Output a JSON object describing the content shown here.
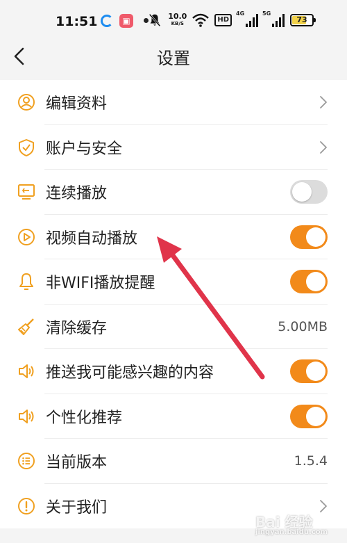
{
  "status_bar": {
    "time": "11:51",
    "speed_value": "10.0",
    "speed_unit": "KB/S",
    "hd": "HD",
    "sig1_label": "4G",
    "sig2_label": "5G",
    "battery": "73",
    "battery_level_percent": 73
  },
  "header": {
    "title": "设置"
  },
  "colors": {
    "accent": "#f28a1a",
    "icon": "#f0a020",
    "toggle_off": "#dcdcdc",
    "arrow": "#e0344a"
  },
  "settings": [
    {
      "label": "编辑资料",
      "icon": "user-icon",
      "control": "chevron"
    },
    {
      "label": "账户与安全",
      "icon": "shield-icon",
      "control": "chevron"
    },
    {
      "label": "连续播放",
      "icon": "screen-icon",
      "control": "toggle",
      "on": false
    },
    {
      "label": "视频自动播放",
      "icon": "play-icon",
      "control": "toggle",
      "on": true
    },
    {
      "label": "非WIFI播放提醒",
      "icon": "bell-icon",
      "control": "toggle",
      "on": true
    },
    {
      "label": "清除缓存",
      "icon": "broom-icon",
      "control": "value",
      "value": "5.00MB"
    },
    {
      "label": "推送我可能感兴趣的内容",
      "icon": "speaker-icon",
      "control": "toggle",
      "on": true
    },
    {
      "label": "个性化推荐",
      "icon": "speaker-icon",
      "control": "toggle",
      "on": true
    },
    {
      "label": "当前版本",
      "icon": "list-icon",
      "control": "value",
      "value": "1.5.4"
    },
    {
      "label": "关于我们",
      "icon": "info-icon",
      "control": "chevron"
    }
  ],
  "watermark": {
    "brand": "Bai 经验",
    "sub": "jingyan.baidu.com"
  }
}
